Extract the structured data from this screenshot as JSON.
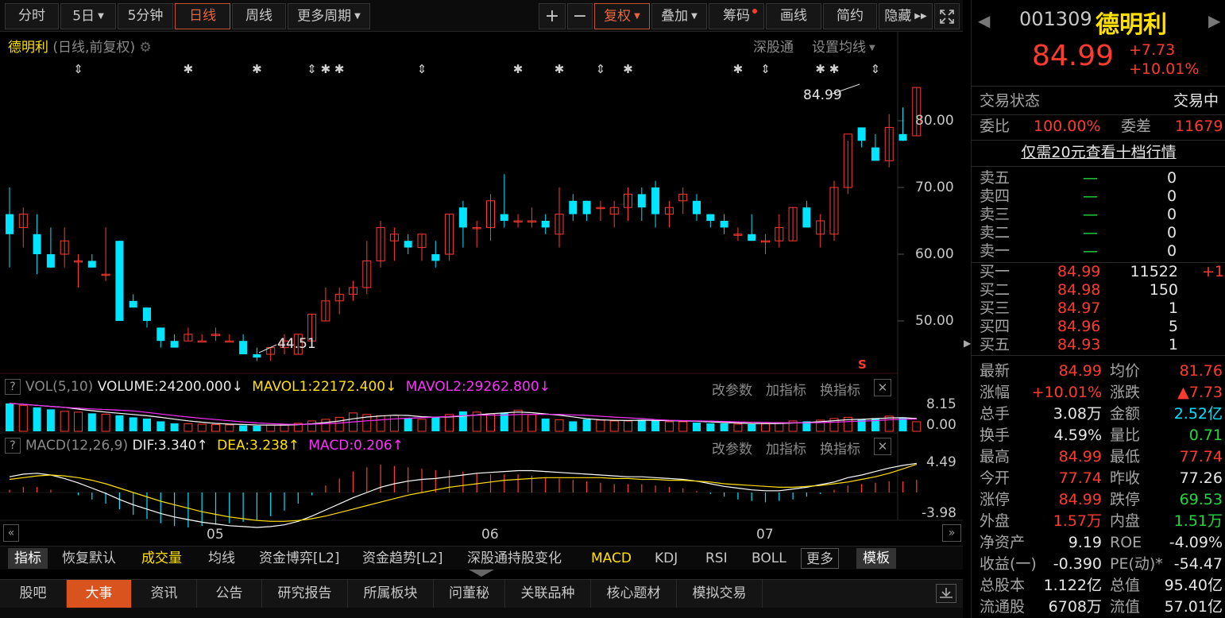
{
  "toolbar": {
    "items": [
      "分时",
      "5日",
      "5分钟",
      "日线",
      "周线",
      "更多周期"
    ],
    "right_items": [
      "+",
      "−",
      "复权",
      "叠加",
      "筹码",
      "画线",
      "简约",
      "隐藏"
    ],
    "expand_icon": "expand-icon"
  },
  "chart_header": {
    "title": "德明利",
    "subtitle": "(日线,前复权)",
    "link1": "深股通",
    "link2": "设置均线",
    "high_label": "84.99",
    "low_label": "44.51",
    "signal_s": "S"
  },
  "price_axis": [
    "80.00",
    "70.00",
    "60.00",
    "50.00"
  ],
  "vol": {
    "name": "VOL(5,10)",
    "volume": "VOLUME:24200.000",
    "mavol1": "MAVOL1:22172.400",
    "mavol2": "MAVOL2:29262.800",
    "arrow_down": "↓",
    "btn1": "改参数",
    "btn2": "加指标",
    "btn3": "换指标",
    "axis_top": "8.15",
    "axis_bottom": "0.00"
  },
  "macd": {
    "name": "MACD(12,26,9)",
    "dif": "DIF:3.340",
    "dea": "DEA:3.238",
    "macd": "MACD:0.206",
    "arrow_up": "↑",
    "btn1": "改参数",
    "btn2": "加指标",
    "btn3": "换指标",
    "axis_top": "4.49",
    "axis_bottom": "-3.98"
  },
  "date_axis": [
    "05",
    "06",
    "07"
  ],
  "chart_data": {
    "type": "candlestick",
    "title": "德明利 (日线,前复权)",
    "ylim": [
      44,
      86
    ],
    "yticks": [
      80,
      70,
      60,
      50
    ],
    "x_labels": [
      "05",
      "06",
      "07"
    ],
    "candles": [
      [
        66,
        70,
        58,
        63
      ],
      [
        64,
        67,
        61,
        66
      ],
      [
        63,
        66,
        57,
        60
      ],
      [
        60,
        64,
        58,
        58
      ],
      [
        60,
        64,
        58,
        62
      ],
      [
        59,
        60,
        55,
        59
      ],
      [
        59,
        60,
        58,
        58
      ],
      [
        57,
        64,
        56,
        57
      ],
      [
        62,
        62,
        50,
        50
      ],
      [
        53,
        54,
        52,
        52
      ],
      [
        52,
        52,
        49,
        50
      ],
      [
        49,
        49,
        46,
        47
      ],
      [
        47,
        48,
        46,
        46
      ],
      [
        47,
        49,
        47,
        48
      ],
      [
        47,
        48,
        47,
        47
      ],
      [
        48,
        49,
        47,
        48
      ],
      [
        47,
        48,
        47,
        47
      ],
      [
        47,
        48,
        45,
        45
      ],
      [
        45,
        46,
        44,
        44.51
      ],
      [
        45,
        46,
        44,
        46
      ],
      [
        46,
        48,
        45,
        47
      ],
      [
        45,
        48,
        45,
        48
      ],
      [
        47,
        51,
        47,
        51
      ],
      [
        50,
        55,
        50,
        53
      ],
      [
        53,
        55,
        51,
        54
      ],
      [
        54,
        56,
        53,
        55
      ],
      [
        55,
        62,
        54,
        59
      ],
      [
        59,
        65,
        58,
        64
      ],
      [
        62,
        64,
        59,
        63
      ],
      [
        62,
        63,
        60,
        61
      ],
      [
        61,
        63,
        59,
        63
      ],
      [
        60,
        62,
        58,
        59
      ],
      [
        60,
        66,
        59,
        66
      ],
      [
        67,
        68,
        61,
        64
      ],
      [
        64,
        65,
        61,
        64
      ],
      [
        64,
        69,
        62,
        68
      ],
      [
        66,
        72,
        64,
        65
      ],
      [
        65,
        66,
        64,
        65
      ],
      [
        65,
        67,
        64,
        65
      ],
      [
        65,
        66,
        63,
        64
      ],
      [
        63,
        70,
        61,
        66
      ],
      [
        68,
        69,
        65,
        66
      ],
      [
        68,
        68,
        65,
        66
      ],
      [
        67,
        68,
        65,
        67
      ],
      [
        66,
        68,
        64,
        67
      ],
      [
        67,
        70,
        65,
        69
      ],
      [
        69,
        70,
        65,
        67
      ],
      [
        70,
        71,
        64,
        66
      ],
      [
        66,
        68,
        64,
        67
      ],
      [
        68,
        70,
        66,
        69
      ],
      [
        68,
        69,
        65,
        66
      ],
      [
        66,
        66,
        64,
        65
      ],
      [
        65,
        66,
        63,
        64
      ],
      [
        63,
        64,
        62,
        63
      ],
      [
        63,
        66,
        62,
        62
      ],
      [
        62,
        63,
        60,
        62
      ],
      [
        62,
        66,
        61,
        64
      ],
      [
        62,
        67,
        62,
        67
      ],
      [
        67,
        68,
        64,
        64
      ],
      [
        63,
        66,
        61,
        65
      ],
      [
        63,
        71,
        62,
        70
      ],
      [
        70,
        77,
        69,
        78
      ],
      [
        79,
        79,
        76,
        77
      ],
      [
        76,
        78,
        75,
        74
      ],
      [
        74,
        81,
        73,
        79
      ],
      [
        78,
        82,
        77,
        77
      ],
      [
        77.74,
        84.99,
        77.74,
        84.99
      ]
    ],
    "volumes": [
      7.0,
      6.5,
      6.0,
      5.5,
      5.0,
      4.8,
      4.5,
      4.3,
      4.0,
      3.5,
      3.2,
      2.5,
      2.0,
      1.9,
      1.8,
      1.7,
      1.6,
      1.5,
      1.4,
      1.6,
      1.8,
      2.0,
      2.6,
      3.0,
      3.5,
      4.6,
      4.2,
      3.9,
      4.0,
      3.2,
      3.0,
      3.6,
      4.2,
      5.0,
      4.8,
      4.4,
      4.7,
      5.3,
      4.2,
      3.2,
      2.9,
      2.5,
      3.0,
      2.8,
      2.6,
      2.6,
      2.9,
      2.7,
      2.4,
      2.4,
      2.2,
      2.0,
      2.0,
      1.8,
      1.8,
      2.0,
      2.2,
      2.6,
      2.5,
      2.8,
      3.2,
      3.5,
      3.0,
      3.3,
      3.8,
      3.5,
      2.4
    ],
    "macd_bars": [
      0.2,
      0.4,
      0.4,
      0.2,
      0.0,
      -0.2,
      -0.5,
      -0.8,
      -1.2,
      -1.6,
      -1.9,
      -2.2,
      -2.4,
      -2.5,
      -2.4,
      -2.3,
      -2.2,
      -2.1,
      -2.0,
      -1.7,
      -1.3,
      -0.8,
      -0.2,
      0.5,
      1.0,
      1.5,
      1.8,
      2.0,
      1.9,
      1.8,
      1.7,
      1.6,
      1.6,
      1.5,
      1.4,
      1.3,
      1.3,
      1.3,
      1.2,
      1.1,
      1.0,
      0.9,
      0.8,
      0.7,
      0.6,
      0.6,
      0.6,
      0.5,
      0.4,
      0.3,
      0.1,
      -0.1,
      -0.3,
      -0.5,
      -0.6,
      -0.7,
      -0.6,
      -0.5,
      -0.3,
      -0.1,
      0.2,
      0.5,
      0.6,
      0.7,
      0.8,
      0.8,
      0.9
    ],
    "dif": [
      1.8,
      2.1,
      2.2,
      2.0,
      1.6,
      1.1,
      0.5,
      -0.1,
      -0.8,
      -1.4,
      -1.9,
      -2.4,
      -2.8,
      -3.1,
      -3.4,
      -3.6,
      -3.8,
      -3.9,
      -4.0,
      -3.9,
      -3.7,
      -3.3,
      -2.7,
      -2.0,
      -1.3,
      -0.6,
      0.0,
      0.6,
      1.0,
      1.3,
      1.5,
      1.6,
      1.8,
      2.0,
      2.2,
      2.3,
      2.4,
      2.5,
      2.5,
      2.4,
      2.3,
      2.2,
      2.1,
      2.0,
      1.9,
      1.8,
      1.8,
      1.7,
      1.6,
      1.5,
      1.3,
      1.0,
      0.7,
      0.5,
      0.3,
      0.2,
      0.2,
      0.4,
      0.6,
      0.9,
      1.2,
      1.7,
      2.0,
      2.4,
      2.8,
      3.1,
      3.34
    ],
    "dea": [
      1.5,
      1.7,
      1.9,
      2.0,
      1.9,
      1.7,
      1.4,
      1.0,
      0.5,
      0.0,
      -0.5,
      -1.0,
      -1.4,
      -1.8,
      -2.2,
      -2.5,
      -2.8,
      -3.0,
      -3.2,
      -3.3,
      -3.3,
      -3.2,
      -3.0,
      -2.7,
      -2.3,
      -1.9,
      -1.5,
      -1.1,
      -0.7,
      -0.3,
      0.0,
      0.3,
      0.6,
      0.8,
      1.0,
      1.2,
      1.4,
      1.5,
      1.6,
      1.7,
      1.7,
      1.7,
      1.7,
      1.7,
      1.6,
      1.6,
      1.5,
      1.5,
      1.4,
      1.4,
      1.3,
      1.2,
      1.0,
      0.9,
      0.8,
      0.7,
      0.6,
      0.6,
      0.7,
      0.8,
      1.0,
      1.2,
      1.5,
      1.8,
      2.2,
      2.7,
      3.238
    ]
  },
  "indicator_tabs": [
    "指标",
    "恢复默认",
    "成交量",
    "均线",
    "资金博弈[L2]",
    "资金趋势[L2]",
    "深股通持股变化",
    "MACD",
    "KDJ",
    "RSI",
    "BOLL",
    "更多",
    "模板"
  ],
  "bottom_tabs": [
    "股吧",
    "大事",
    "资讯",
    "公告",
    "研究报告",
    "所属板块",
    "问董秘",
    "关联品种",
    "核心题材",
    "模拟交易"
  ],
  "quote": {
    "code": "001309",
    "name": "德明利",
    "price": "84.99",
    "change": "+7.73",
    "change_pct": "+10.01%",
    "status_label": "交易状态",
    "status_value": "交易中",
    "weibi_label": "委比",
    "weibi_value": "100.00%",
    "weicha_label": "委差",
    "weicha_value": "11679",
    "promo": "仅需20元查看十档行情",
    "sell": [
      {
        "label": "卖五",
        "price": "—",
        "vol": "0"
      },
      {
        "label": "卖四",
        "price": "—",
        "vol": "0"
      },
      {
        "label": "卖三",
        "price": "—",
        "vol": "0"
      },
      {
        "label": "卖二",
        "price": "—",
        "vol": "0"
      },
      {
        "label": "卖一",
        "price": "—",
        "vol": "0"
      }
    ],
    "buy": [
      {
        "label": "买一",
        "price": "84.99",
        "vol": "11522",
        "chg": "+1"
      },
      {
        "label": "买二",
        "price": "84.98",
        "vol": "150",
        "chg": ""
      },
      {
        "label": "买三",
        "price": "84.97",
        "vol": "1",
        "chg": ""
      },
      {
        "label": "买四",
        "price": "84.96",
        "vol": "5",
        "chg": ""
      },
      {
        "label": "买五",
        "price": "84.93",
        "vol": "1",
        "chg": ""
      }
    ],
    "stats": [
      {
        "l1": "最新",
        "v1": "84.99",
        "c1": "red",
        "l2": "均价",
        "v2": "81.76",
        "c2": "red"
      },
      {
        "l1": "涨幅",
        "v1": "+10.01%",
        "c1": "red",
        "l2": "涨跌",
        "v2": "▲7.73",
        "c2": "red"
      },
      {
        "l1": "总手",
        "v1": "3.08万",
        "c1": "white",
        "l2": "金额",
        "v2": "2.52亿",
        "c2": "cyan"
      },
      {
        "l1": "换手",
        "v1": "4.59%",
        "c1": "white",
        "l2": "量比",
        "v2": "0.71",
        "c2": "green"
      },
      {
        "l1": "最高",
        "v1": "84.99",
        "c1": "red",
        "l2": "最低",
        "v2": "77.74",
        "c2": "red"
      },
      {
        "l1": "今开",
        "v1": "77.74",
        "c1": "red",
        "l2": "昨收",
        "v2": "77.26",
        "c2": "white"
      },
      {
        "l1": "涨停",
        "v1": "84.99",
        "c1": "red",
        "l2": "跌停",
        "v2": "69.53",
        "c2": "green"
      },
      {
        "l1": "外盘",
        "v1": "1.57万",
        "c1": "red",
        "l2": "内盘",
        "v2": "1.51万",
        "c2": "green"
      },
      {
        "l1": "净资产",
        "v1": "9.19",
        "c1": "white",
        "l2": "ROE",
        "v2": "-4.09%",
        "c2": "white"
      },
      {
        "l1": "收益(一)",
        "v1": "-0.390",
        "c1": "white",
        "l2": "PE(动)*",
        "v2": "-54.47",
        "c2": "white"
      },
      {
        "l1": "总股本",
        "v1": "1.122亿",
        "c1": "white",
        "l2": "总值",
        "v2": "95.40亿",
        "c2": "white"
      },
      {
        "l1": "流通股",
        "v1": "6708万",
        "c1": "white",
        "l2": "流值",
        "v2": "57.01亿",
        "c2": "white"
      }
    ]
  }
}
